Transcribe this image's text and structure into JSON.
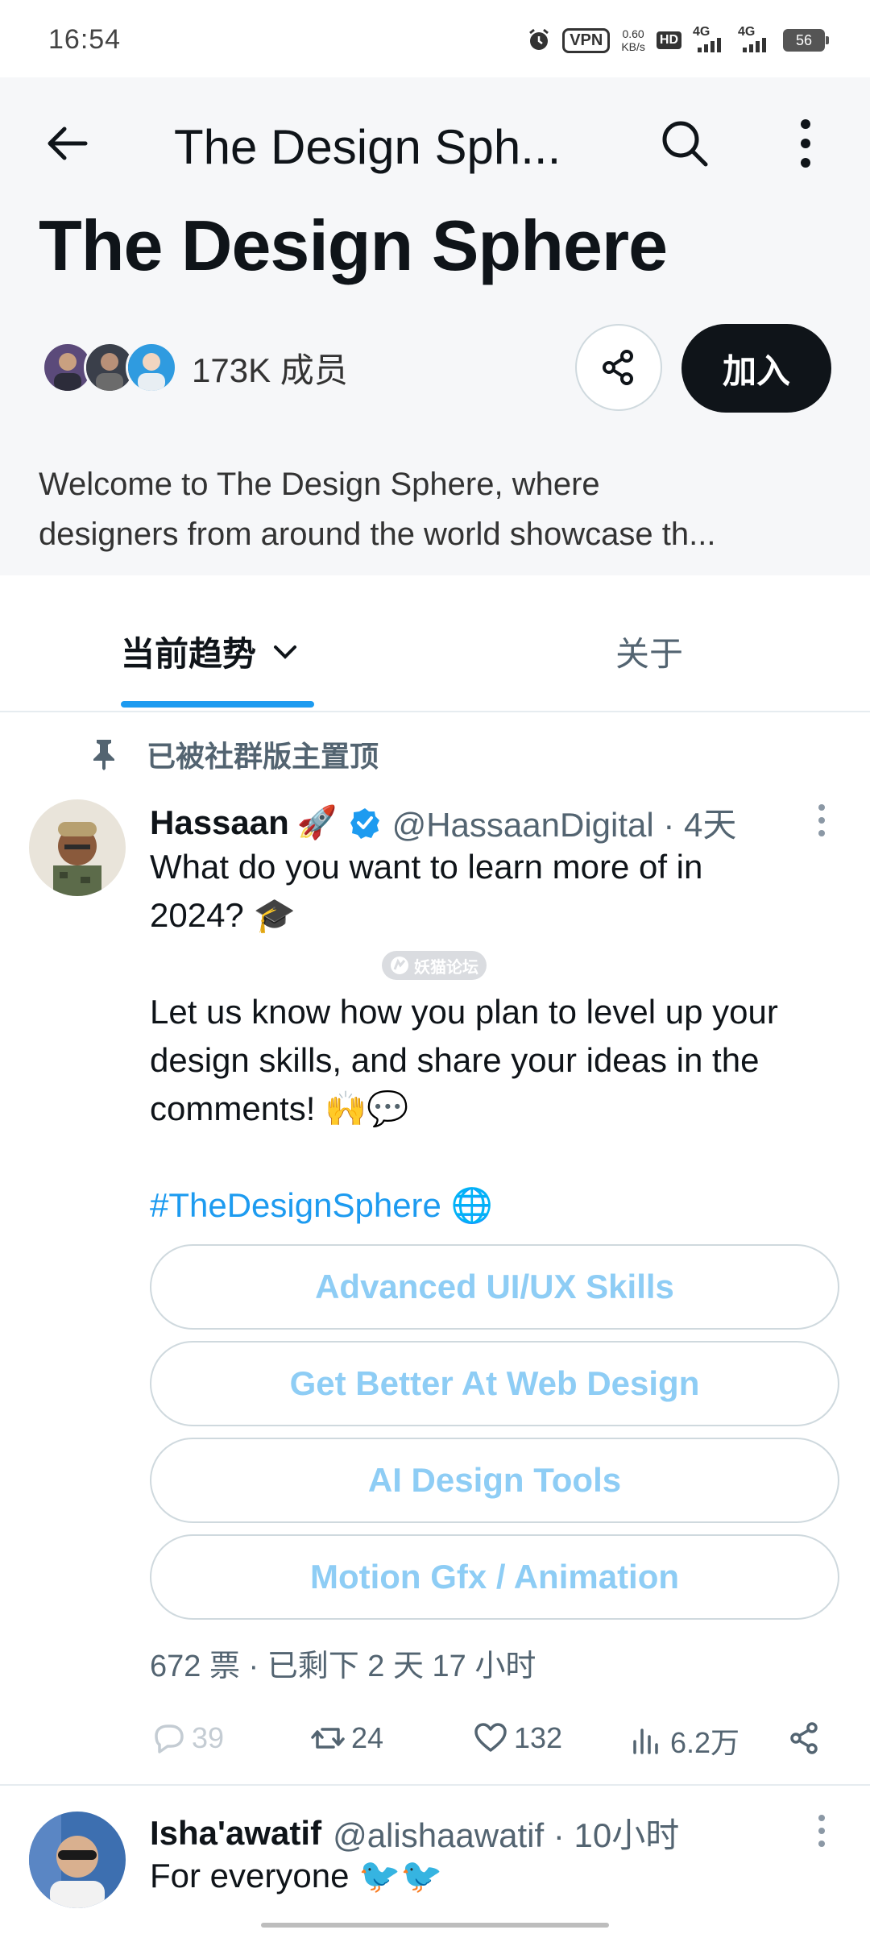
{
  "status_bar": {
    "time": "16:54",
    "vpn": "VPN",
    "speed_value": "0.60",
    "speed_unit": "KB/s",
    "hd": "HD",
    "net1": "4G",
    "net2": "4G",
    "battery": "56"
  },
  "header": {
    "top_title": "The Design Sph...",
    "community_title": "The Design Sphere",
    "members_count": "173K 成员",
    "join_label": "加入",
    "description_line1": "Welcome to The Design Sphere, where",
    "description_line2": "designers from around the world showcase th..."
  },
  "tabs": {
    "trending": "当前趋势",
    "about": "关于"
  },
  "post": {
    "pinned_label": "已被社群版主置顶",
    "author_name": "Hassaan",
    "author_emoji": "🚀",
    "handle_time": "@HassaanDigital · 4天",
    "question_line1": "What do you want to learn more of in",
    "question_line2": "2024? 🎓",
    "body_line1": "Let us know how you plan to level up your",
    "body_line2": "design skills, and share your ideas in the",
    "body_line3": "comments! 🙌💬",
    "hashtag": "#TheDesignSphere 🌐",
    "poll_options": [
      "Advanced UI/UX Skills",
      "Get Better At Web Design",
      "AI Design Tools",
      "Motion Gfx / Animation"
    ],
    "poll_meta": "672 票 · 已剩下 2 天 17 小时",
    "replies": "39",
    "reposts": "24",
    "likes": "132",
    "views": "6.2万"
  },
  "watermark": "妖猫论坛",
  "post2": {
    "author_name": "Isha'awatif",
    "handle_time": "@alishaawatif · 10小时",
    "text": "For everyone 🐦🐦"
  },
  "colors": {
    "accent": "#1d9bf0",
    "join_bg": "#0f1419",
    "poll_text": "#8ecdf5",
    "header_bg": "#f6f7f9"
  }
}
